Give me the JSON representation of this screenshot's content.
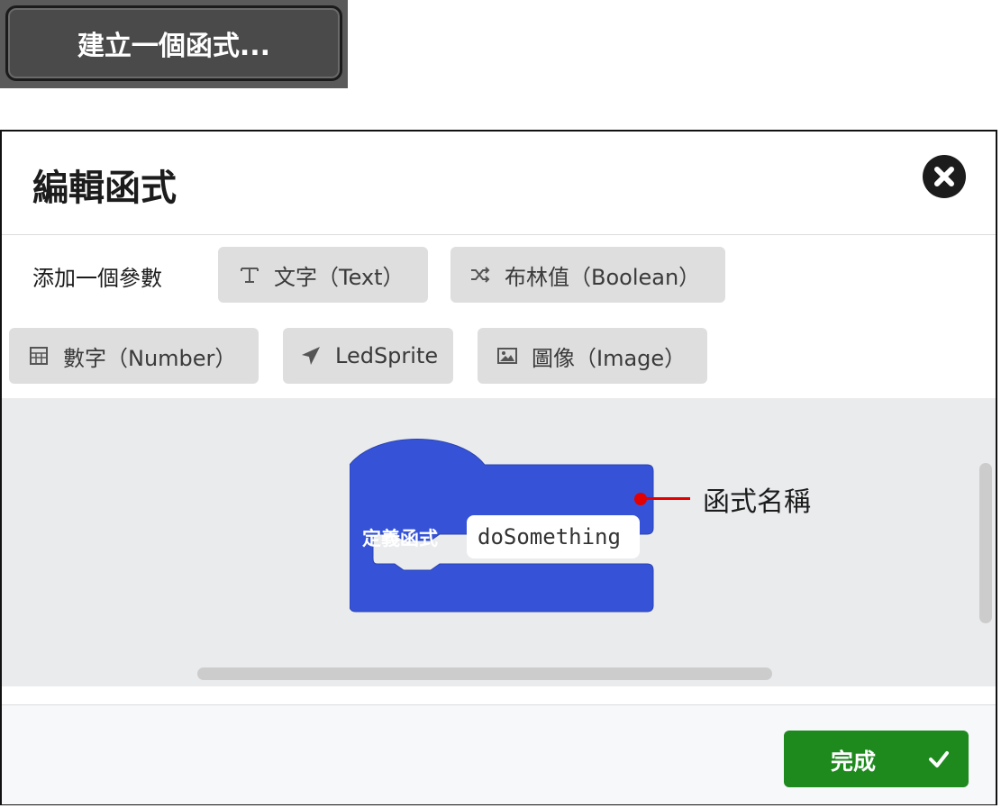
{
  "top_button": {
    "label": "建立一個函式..."
  },
  "dialog": {
    "title": "編輯函式",
    "add_param_label": "添加一個參數",
    "param_buttons": [
      {
        "label": "文字（Text）",
        "icon": "text-icon"
      },
      {
        "label": "布林值（Boolean）",
        "icon": "shuffle-icon"
      },
      {
        "label": "數字（Number）",
        "icon": "calculator-icon"
      },
      {
        "label": "LedSprite",
        "icon": "paper-plane-icon"
      },
      {
        "label": "圖像（Image）",
        "icon": "image-icon"
      }
    ],
    "block": {
      "label": "定義函式",
      "name_value": "doSomething",
      "color": "#3653d8"
    },
    "annotation": "函式名稱",
    "done_label": "完成"
  },
  "colors": {
    "done_button": "#1e8a1e",
    "annotation": "#e30000",
    "workspace": "#e9ebed"
  }
}
